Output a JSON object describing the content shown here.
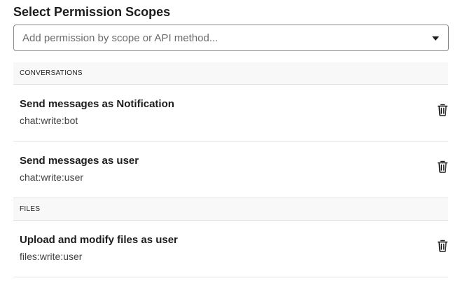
{
  "page": {
    "title": "Select Permission Scopes"
  },
  "search": {
    "placeholder": "Add permission by scope or API method..."
  },
  "groups": [
    {
      "label": "CONVERSATIONS",
      "scopes": [
        {
          "title": "Send messages as Notification",
          "code": "chat:write:bot"
        },
        {
          "title": "Send messages as user",
          "code": "chat:write:user"
        }
      ]
    },
    {
      "label": "FILES",
      "scopes": [
        {
          "title": "Upload and modify files as user",
          "code": "files:write:user"
        }
      ]
    }
  ],
  "icons": {
    "dropdown": "chevron-down-icon",
    "remove": "trash-icon"
  }
}
